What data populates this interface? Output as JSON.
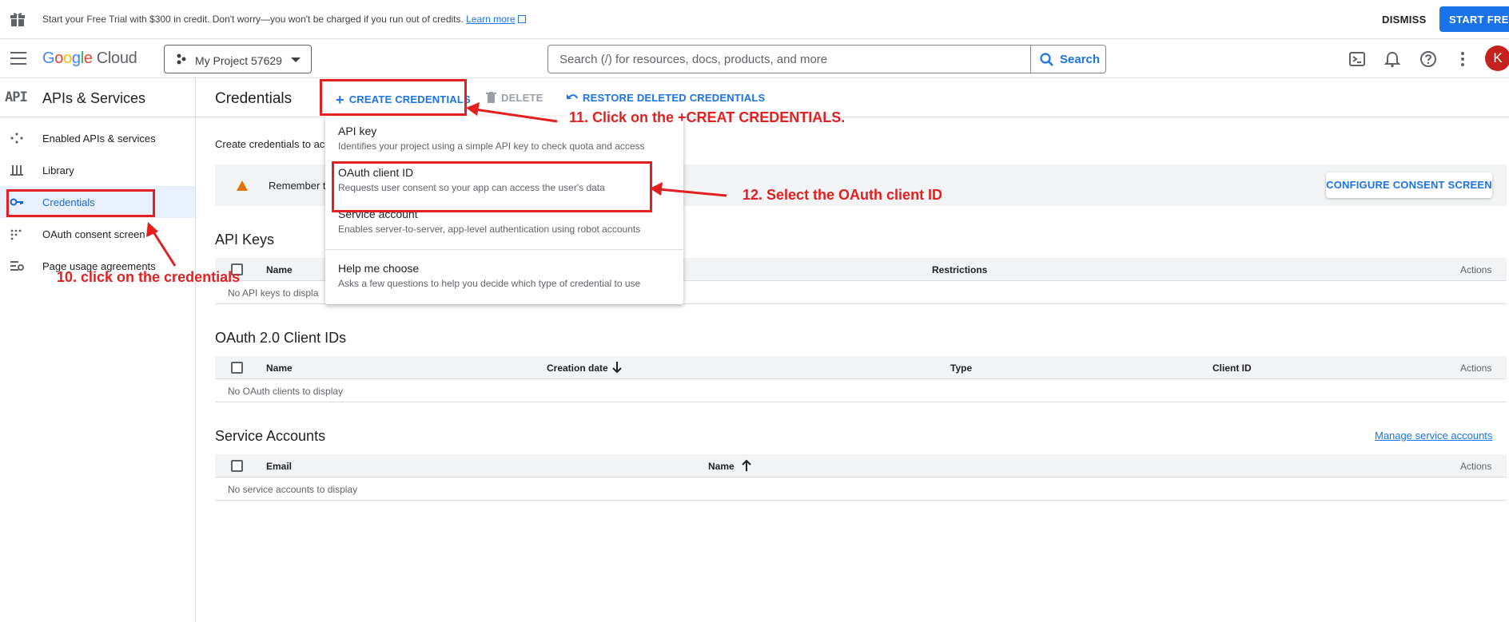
{
  "banner": {
    "icon": "gift-icon",
    "message": "Start your Free Trial with $300 in credit. Don't worry—you won't be charged if you run out of credits.",
    "learn_more": "Learn more",
    "dismiss": "DISMISS",
    "start_free": "START FREE"
  },
  "topbar": {
    "logo_google": [
      "G",
      "o",
      "o",
      "g",
      "l",
      "e"
    ],
    "logo_cloud": "Cloud",
    "project": "My Project 57629",
    "search_placeholder": "Search (/) for resources, docs, products, and more",
    "search_button": "Search",
    "avatar_letter": "K"
  },
  "sidebar": {
    "logo": "API",
    "title": "APIs & Services",
    "items": [
      {
        "label": "Enabled APIs & services",
        "icon": "enabled-apis-icon"
      },
      {
        "label": "Library",
        "icon": "library-icon"
      },
      {
        "label": "Credentials",
        "icon": "key-icon",
        "active": true
      },
      {
        "label": "OAuth consent screen",
        "icon": "consent-icon"
      },
      {
        "label": "Page usage agreements",
        "icon": "settings-list-icon"
      }
    ]
  },
  "content": {
    "title": "Credentials",
    "create": "CREATE CREDENTIALS",
    "delete": "DELETE",
    "restore": "RESTORE DELETED CREDENTIALS",
    "intro": "Create credentials to acc",
    "notice": "Remember t",
    "configure": "CONFIGURE CONSENT SCREEN"
  },
  "api_keys": {
    "title": "API Keys",
    "columns": [
      "Name",
      "Restrictions",
      "Actions"
    ],
    "empty": "No API keys to displa"
  },
  "oauth": {
    "title": "OAuth 2.0 Client IDs",
    "columns": [
      "Name",
      "Creation date",
      "Type",
      "Client ID",
      "Actions"
    ],
    "empty": "No OAuth clients to display"
  },
  "service_accounts": {
    "title": "Service Accounts",
    "manage": "Manage service accounts",
    "columns": [
      "Email",
      "Name",
      "Actions"
    ],
    "empty": "No service accounts to display"
  },
  "menu": {
    "items": [
      {
        "title": "API key",
        "desc": "Identifies your project using a simple API key to check quota and access"
      },
      {
        "title": "OAuth client ID",
        "desc": "Requests user consent so your app can access the user's data"
      },
      {
        "title": "Service account",
        "desc": "Enables server-to-server, app-level authentication using robot accounts"
      },
      {
        "title": "Help me choose",
        "desc": "Asks a few questions to help you decide which type of credential to use"
      }
    ]
  },
  "annotations": {
    "step10": "10. click on the credentials",
    "step11": "11. Click on the +CREAT CREDENTIALS.",
    "step12": "12. Select the OAuth client ID",
    "color": "#e41f1f"
  },
  "colors": {
    "accent": "#1a73e8",
    "active_bg": "#e8f0fe",
    "warning": "#e37400",
    "avatar": "#c5221f"
  }
}
